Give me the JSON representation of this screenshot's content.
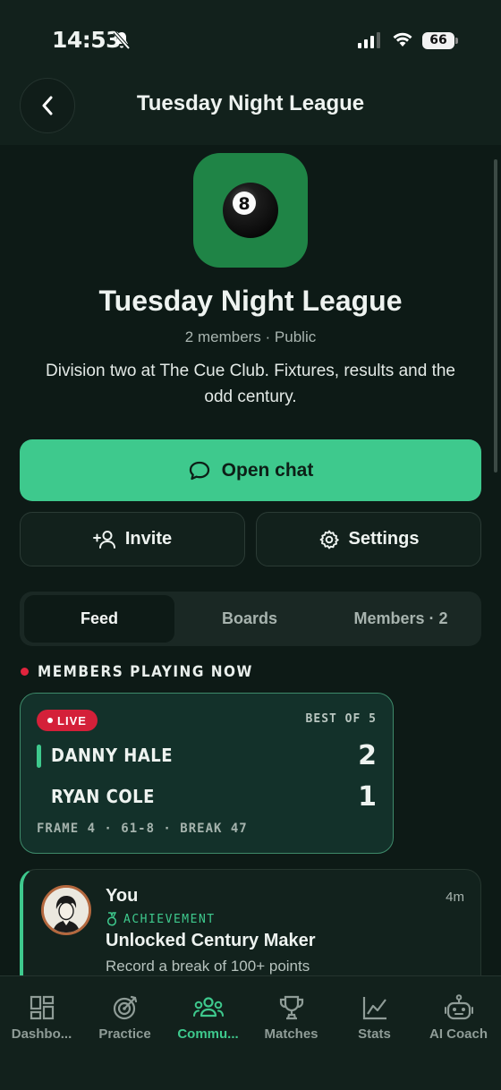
{
  "status_bar": {
    "time": "14:53",
    "battery": "66"
  },
  "header": {
    "title": "Tuesday Night League",
    "back_icon": "chevron-left-icon"
  },
  "group": {
    "name": "Tuesday Night League",
    "meta": "2 members · Public",
    "description": "Division two at The Cue Club. Fixtures, results and the odd century.",
    "icon": "eight-ball-icon",
    "icon_bg": "#1f8446"
  },
  "actions": {
    "open_chat": "Open chat",
    "invite": "Invite",
    "settings": "Settings"
  },
  "tabs": [
    {
      "label": "Feed",
      "active": true
    },
    {
      "label": "Boards",
      "active": false
    },
    {
      "label": "Members · 2",
      "active": false
    }
  ],
  "playing_now": {
    "heading": "MEMBERS PLAYING NOW",
    "match": {
      "status": "LIVE",
      "format": "BEST OF 5",
      "players": [
        {
          "name": "DANNY HALE",
          "score": "2"
        },
        {
          "name": "RYAN COLE",
          "score": "1"
        }
      ],
      "frame_info": "FRAME 4 · 61-8 · BREAK 47"
    }
  },
  "feed": [
    {
      "author": "You",
      "time": "4m",
      "type": "ACHIEVEMENT",
      "headline": "Unlocked Century Maker",
      "sub": "Record a break of 100+ points"
    }
  ],
  "bottom_nav": [
    {
      "label": "Dashbo...",
      "icon": "dashboard-icon",
      "active": false
    },
    {
      "label": "Practice",
      "icon": "target-icon",
      "active": false
    },
    {
      "label": "Commu...",
      "icon": "community-icon",
      "active": true
    },
    {
      "label": "Matches",
      "icon": "trophy-icon",
      "active": false
    },
    {
      "label": "Stats",
      "icon": "chart-icon",
      "active": false
    },
    {
      "label": "AI Coach",
      "icon": "robot-icon",
      "active": false
    }
  ],
  "colors": {
    "accent": "#3ec98d",
    "background": "#0d1a16",
    "live_red": "#d42039"
  }
}
